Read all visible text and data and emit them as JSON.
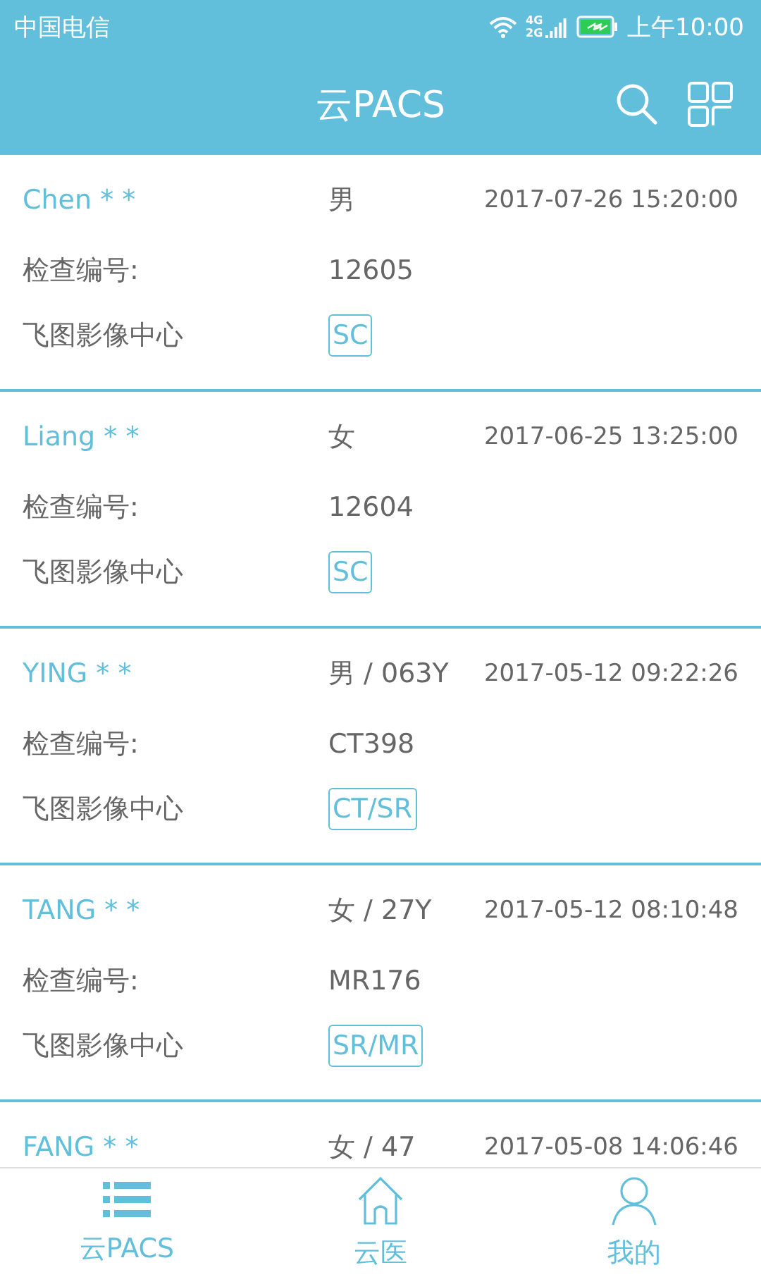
{
  "status_bar": {
    "carrier": "中国电信",
    "network": "4G 2G",
    "time": "上午10:00"
  },
  "header": {
    "title": "云PACS"
  },
  "records": [
    {
      "name": "Chen * *",
      "patient": "男",
      "datetime": "2017-07-26 15:20:00",
      "id_label": "检查编号:",
      "exam_id": "12605",
      "center": "飞图影像中心",
      "modality": "SC"
    },
    {
      "name": "Liang * *",
      "patient": "女",
      "datetime": "2017-06-25 13:25:00",
      "id_label": "检查编号:",
      "exam_id": "12604",
      "center": "飞图影像中心",
      "modality": "SC"
    },
    {
      "name": "YING * *",
      "patient": "男 / 063Y",
      "datetime": "2017-05-12 09:22:26",
      "id_label": "检查编号:",
      "exam_id": "CT398",
      "center": "飞图影像中心",
      "modality": "CT/SR"
    },
    {
      "name": "TANG * *",
      "patient": "女 / 27Y",
      "datetime": "2017-05-12 08:10:48",
      "id_label": "检查编号:",
      "exam_id": "MR176",
      "center": "飞图影像中心",
      "modality": "SR/MR"
    },
    {
      "name": "FANG * *",
      "patient": "女 / 47",
      "datetime": "2017-05-08 14:06:46"
    }
  ],
  "bottom_nav": [
    {
      "label": "云PACS",
      "kind": "list",
      "selected": true
    },
    {
      "label": "云医",
      "kind": "home",
      "selected": false
    },
    {
      "label": "我的",
      "kind": "user",
      "selected": false
    }
  ]
}
